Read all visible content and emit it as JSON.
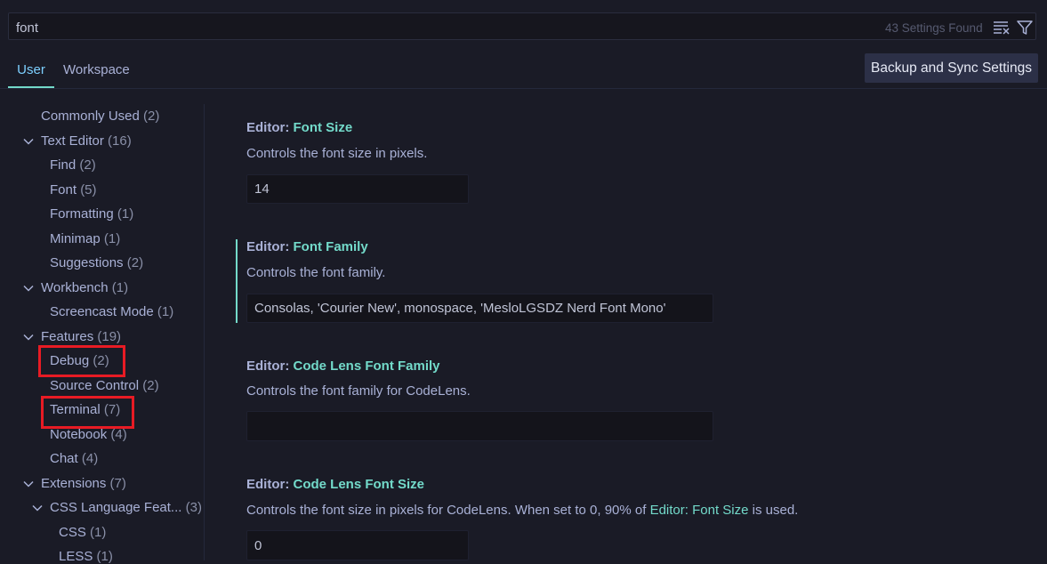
{
  "search": {
    "value": "font",
    "results_count": "43 Settings Found",
    "clear_icon": "clear-filter-icon",
    "filter_icon": "filter-icon"
  },
  "tabs": [
    {
      "label": "User",
      "active": true
    },
    {
      "label": "Workspace",
      "active": false
    }
  ],
  "sync_button": "Backup and Sync Settings",
  "toc": [
    {
      "label": "Commonly Used",
      "count": "(2)"
    },
    {
      "label": "Text Editor",
      "count": "(16)",
      "expanded": true
    },
    {
      "label": "Find",
      "count": "(2)"
    },
    {
      "label": "Font",
      "count": "(5)"
    },
    {
      "label": "Formatting",
      "count": "(1)"
    },
    {
      "label": "Minimap",
      "count": "(1)"
    },
    {
      "label": "Suggestions",
      "count": "(2)"
    },
    {
      "label": "Workbench",
      "count": "(1)",
      "expanded": true
    },
    {
      "label": "Screencast Mode",
      "count": "(1)"
    },
    {
      "label": "Features",
      "count": "(19)",
      "expanded": true
    },
    {
      "label": "Debug",
      "count": "(2)",
      "highlighted": true
    },
    {
      "label": "Source Control",
      "count": "(2)"
    },
    {
      "label": "Terminal",
      "count": "(7)",
      "highlighted": true
    },
    {
      "label": "Notebook",
      "count": "(4)"
    },
    {
      "label": "Chat",
      "count": "(4)"
    },
    {
      "label": "Extensions",
      "count": "(7)",
      "expanded": true
    },
    {
      "label": "CSS Language Feat...",
      "count": "(3)",
      "expanded": true
    },
    {
      "label": "CSS",
      "count": "(1)"
    },
    {
      "label": "LESS",
      "count": "(1)"
    }
  ],
  "settings": [
    {
      "category": "Editor: ",
      "name": "Font Size",
      "description": "Controls the font size in pixels.",
      "value": "14"
    },
    {
      "category": "Editor: ",
      "name": "Font Family",
      "description": "Controls the font family.",
      "value": "Consolas, 'Courier New', monospace, 'MesloLGSDZ Nerd Font Mono'",
      "focused": true
    },
    {
      "category": "Editor: ",
      "name": "Code Lens Font Family",
      "description": "Controls the font family for CodeLens.",
      "value": ""
    },
    {
      "category": "Editor: ",
      "name": "Code Lens Font Size",
      "description_before": "Controls the font size in pixels for CodeLens. When set to 0, 90% of ",
      "description_link": "Editor: Font Size",
      "description_after": " is used.",
      "value": "0"
    }
  ],
  "colors": {
    "background": "#1a1b26",
    "accent": "#73daca",
    "highlight_box": "#e81b24",
    "button_bg": "#2c3047"
  }
}
